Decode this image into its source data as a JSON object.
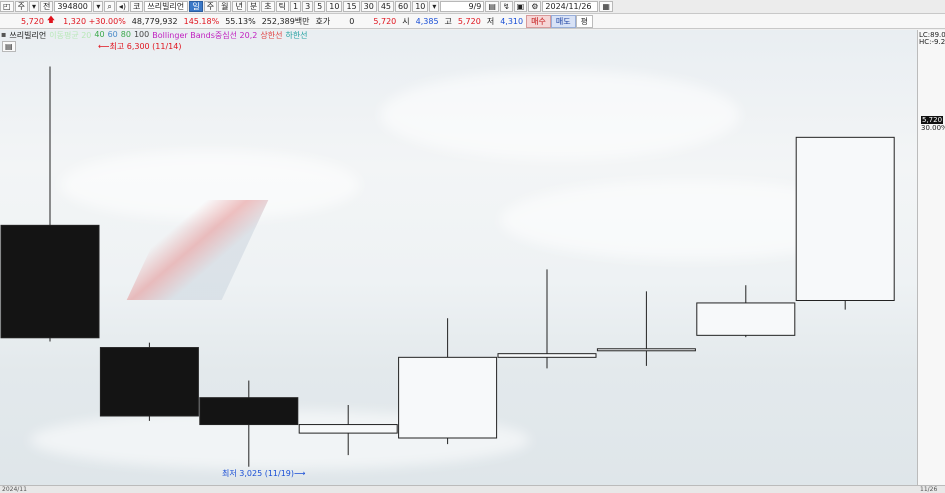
{
  "toolbar": {
    "period_label": "주",
    "type_label": "전",
    "stock_code": "394800",
    "stock_name": "쓰리빌리언",
    "timeframe_day": "일",
    "timeframe_week": "주",
    "timeframe_month": "월",
    "timeframe_year": "년",
    "timeframe_min": "분",
    "timeframe_sec": "초",
    "timeframe_tick": "틱",
    "intervals": [
      "1",
      "3",
      "5",
      "10",
      "15",
      "30",
      "45",
      "60",
      "10"
    ],
    "page_count": "9/9",
    "date": "2024/11/26"
  },
  "info": {
    "price": "5,720",
    "change": "1,320 +30.00%",
    "volume": "48,779,932",
    "vol_ratio": "145.18%",
    "turnover": "55.13%",
    "amount": "252,389백만",
    "quote_label": "호가",
    "quote_value": "0",
    "ask_price": "5,720",
    "open_label": "시",
    "open": "4,385",
    "high_label": "고",
    "high": "5,720",
    "low_label": "저",
    "low": "4,310",
    "buy": "매수",
    "sell": "매도",
    "eq": "평"
  },
  "legend": {
    "name": "쓰리빌리언",
    "ma": "이동평균 20",
    "ma40": "40",
    "ma60": "60",
    "ma80": "80",
    "ma100": "100",
    "bb": "Bollinger Bands중심선 20,2",
    "upper": "상한선",
    "lower": "하한선"
  },
  "annotations": {
    "high": "최고 6,300 (11/14)",
    "low": "최저 3,025 (11/19)"
  },
  "axis": {
    "lc": "LC:89.0",
    "hc": "HC:-9.2",
    "price_tag": "5,720",
    "pct_tag": "30.00%"
  },
  "bottom": {
    "left": "2024/11",
    "right": "11/26"
  },
  "colors": {
    "bear": "#141414",
    "bull": "#f7f9fa",
    "up": "#e0141e",
    "down": "#1a4fd6"
  },
  "chart_data": {
    "type": "candlestick",
    "candles": [
      {
        "open": 5000,
        "high": 6300,
        "low": 4050,
        "close": 4080
      },
      {
        "open": 4000,
        "high": 4040,
        "low": 3400,
        "close": 3440
      },
      {
        "open": 3590,
        "high": 3730,
        "low": 3025,
        "close": 3370
      },
      {
        "open": 3300,
        "high": 3530,
        "low": 3120,
        "close": 3370
      },
      {
        "open": 3260,
        "high": 4240,
        "low": 3210,
        "close": 3920
      },
      {
        "open": 3920,
        "high": 4640,
        "low": 3830,
        "close": 3950
      },
      {
        "open": 3980,
        "high": 4460,
        "low": 3850,
        "close": 3990
      },
      {
        "open": 4100,
        "high": 4510,
        "low": 4085,
        "close": 4365
      },
      {
        "open": 4385,
        "high": 5720,
        "low": 4310,
        "close": 5720
      }
    ],
    "ylim": [
      2900,
      6500
    ]
  }
}
